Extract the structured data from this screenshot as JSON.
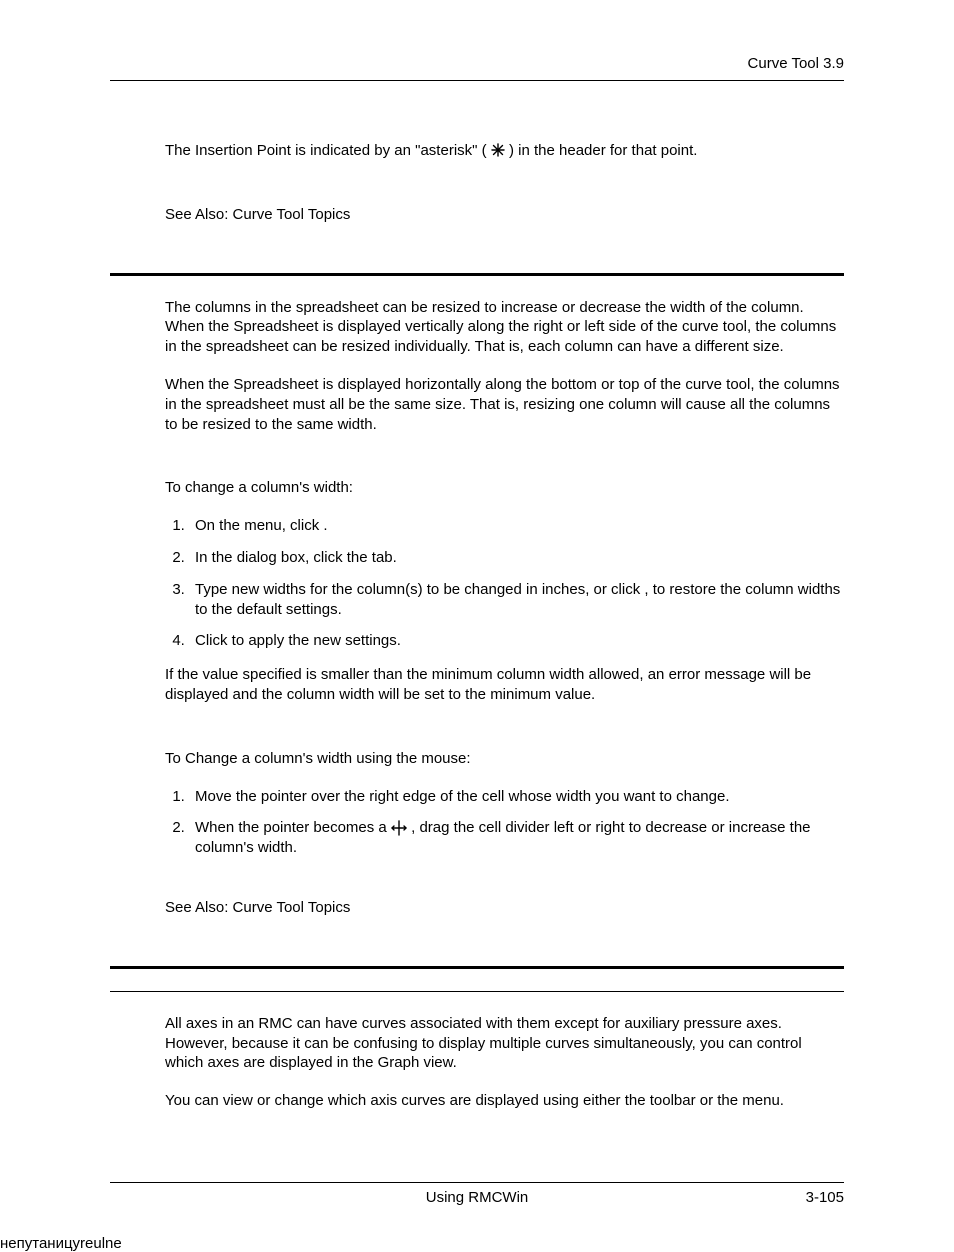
{
  "header": {
    "right": "Curve Tool  3.9"
  },
  "section1": {
    "p1a": "The Insertion Point is indicated by an \"asterisk\" (",
    "p1b": ") in the header for that point.",
    "seeAlso": "See Also: Curve Tool Topics"
  },
  "section2": {
    "p1": "The columns in the spreadsheet can be resized to increase or decrease the width of the column. When the Spreadsheet is displayed vertically along the right or left side of the curve tool, the columns in the spreadsheet can be resized individually. That is, each column can have a different size.",
    "p2": "When the Spreadsheet is displayed horizontally along the bottom or top of the curve tool, the columns in the spreadsheet must all be the same size. That is, resizing one column will cause all the columns to be resized to the same width.",
    "intro1": "To change a column's width:",
    "stepsA": {
      "s1": "On the          menu, click                 .",
      "s2": "In the              dialog box, click the                         tab.",
      "s3": "Type new widths for the column(s) to be changed in inches, or click                              , to restore the column widths to the default settings.",
      "s4": "Click        to apply the new settings."
    },
    "noteA": "If the value specified is smaller than the minimum column width allowed, an error message will be displayed and the column width will be set to the minimum value.",
    "intro2": "To Change a column's width using the mouse:",
    "stepsB": {
      "s1": "Move the pointer over the right edge of the cell whose width you want to change.",
      "s2a": "When the pointer becomes a ",
      "s2b": ", drag the cell divider left or right to decrease or increase the column's width."
    },
    "seeAlso": "See Also: Curve Tool Topics"
  },
  "section3": {
    "p1": "All axes in an RMC can have curves associated with them except for auxiliary pressure axes. However, because it can be confusing to display multiple curves simultaneously, you can control which axes are displayed in the Graph view.",
    "p2": "You can view or change which axis curves are displayed using either the toolbar or the menu."
  },
  "footer": {
    "center": "Using RMCWin",
    "right": "3-105"
  }
}
